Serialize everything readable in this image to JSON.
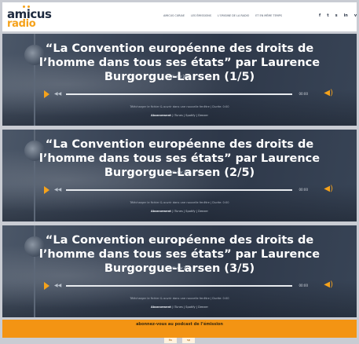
{
  "header": {
    "logo_word1": "amicus",
    "logo_word2": "radio",
    "nav": [
      "AMICUS CURIAE",
      "LES ÉMISSIONS",
      "L'ORIGINE DE LA RADIO",
      "ET EN MÊME TEMPS"
    ],
    "social": [
      "f",
      "t",
      "s",
      "in",
      "v"
    ]
  },
  "episodes": [
    {
      "title": "“La Convention européenne des droits de l’homme dans tous ses états” par Laurence Burgorgue-Larsen (1/5)",
      "date": "8 février 2021",
      "time": "00:00",
      "note": "Télécharger le fichier & ouvrir dans une nouvelle fenêtre | Durée: 0:00",
      "subscribe_label": "Abonnement",
      "subscribe_links": "| iTunes | Spotify | Deezer"
    },
    {
      "title": "“La Convention européenne des droits de l’homme dans tous ses états” par Laurence Burgorgue-Larsen (2/5)",
      "date": "15 février 2021",
      "time": "00:00",
      "note": "Télécharger le fichier & ouvrir dans une nouvelle fenêtre | Durée: 0:00",
      "subscribe_label": "Abonnement",
      "subscribe_links": "| iTunes | Spotify | Deezer"
    },
    {
      "title": "“La Convention européenne des droits de l’homme dans tous ses états” par Laurence Burgorgue-Larsen (3/5)",
      "date": "22 février 2021",
      "time": "00:00",
      "note": "Télécharger le fichier & ouvrir dans une nouvelle fenêtre | Durée: 0:00",
      "subscribe_label": "Abonnement",
      "subscribe_links": "| iTunes | Spotify | Deezer"
    }
  ],
  "footer": {
    "cta": "abonnez-vous au podcast de l’émission",
    "buttons": [
      "Itu",
      "sp"
    ]
  },
  "colors": {
    "accent": "#f5a21b",
    "footer_bg": "#f39413",
    "episode_bg": "#3a4557"
  }
}
